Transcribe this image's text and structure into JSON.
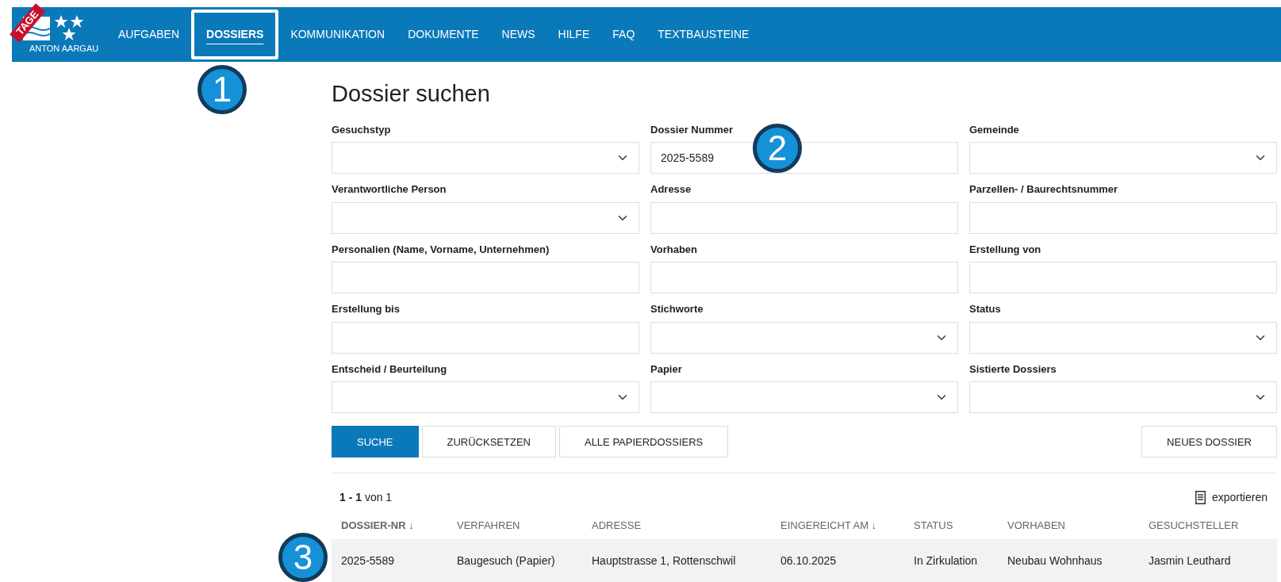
{
  "logo": {
    "ribbon": "TAGE",
    "caption": "ANTON AARGAU"
  },
  "nav": [
    {
      "label": "AUFGABEN",
      "selected": false
    },
    {
      "label": "DOSSIERS",
      "selected": true
    },
    {
      "label": "KOMMUNIKATION",
      "selected": false
    },
    {
      "label": "DOKUMENTE",
      "selected": false
    },
    {
      "label": "NEWS",
      "selected": false
    },
    {
      "label": "HILFE",
      "selected": false
    },
    {
      "label": "FAQ",
      "selected": false
    },
    {
      "label": "TEXTBAUSTEINE",
      "selected": false
    }
  ],
  "title": "Dossier suchen",
  "fields": [
    {
      "label": "Gesuchstyp",
      "kind": "select"
    },
    {
      "label": "Dossier Nummer",
      "kind": "text",
      "value": "2025-5589"
    },
    {
      "label": "Gemeinde",
      "kind": "select"
    },
    {
      "label": "Verantwortliche Person",
      "kind": "select"
    },
    {
      "label": "Adresse",
      "kind": "text"
    },
    {
      "label": "Parzellen- / Baurechtsnummer",
      "kind": "text"
    },
    {
      "label": "Personalien (Name, Vorname, Unternehmen)",
      "kind": "text"
    },
    {
      "label": "Vorhaben",
      "kind": "text"
    },
    {
      "label": "Erstellung von",
      "kind": "text"
    },
    {
      "label": "Erstellung bis",
      "kind": "text"
    },
    {
      "label": "Stichworte",
      "kind": "select"
    },
    {
      "label": "Status",
      "kind": "select"
    },
    {
      "label": "Entscheid / Beurteilung",
      "kind": "select"
    },
    {
      "label": "Papier",
      "kind": "select"
    },
    {
      "label": "Sistierte Dossiers",
      "kind": "select"
    }
  ],
  "buttons": [
    {
      "label": "SUCHE",
      "kind": "primary"
    },
    {
      "label": "ZURÜCKSETZEN",
      "kind": "secondary"
    },
    {
      "label": "ALLE PAPIERDOSSIERS",
      "kind": "secondary"
    },
    {
      "label": "NEUES DOSSIER",
      "kind": "right"
    }
  ],
  "results": {
    "count": "**1 - 1** von 1",
    "export": "exportieren"
  },
  "table": {
    "columns": [
      {
        "label": "DOSSIER-NR",
        "sort": "↓",
        "bold": true
      },
      {
        "label": "VERFAHREN",
        "bold": false
      },
      {
        "label": "ADRESSE",
        "bold": false
      },
      {
        "label": "EINGEREICHT AM",
        "sort": "↓",
        "bold": false
      },
      {
        "label": "STATUS",
        "bold": false
      },
      {
        "label": "VORHABEN",
        "bold": false
      },
      {
        "label": "GESUCHSTELLER",
        "bold": false
      }
    ],
    "rows": [
      [
        "2025-5589",
        "Baugesuch (Papier)",
        "Hauptstrasse 1, Rottenschwil",
        "06.10.2025",
        "In Zirkulation",
        "Neubau Wohnhaus",
        "Jasmin Leuthard"
      ]
    ]
  },
  "callouts": [
    "1",
    "2",
    "3"
  ]
}
